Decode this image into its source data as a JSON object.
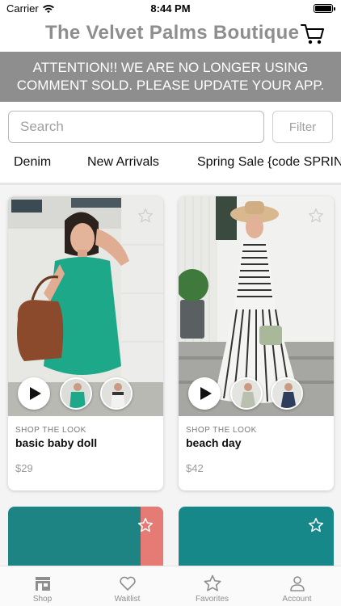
{
  "status_bar": {
    "carrier": "Carrier",
    "time": "8:44 PM"
  },
  "header": {
    "title": "The Velvet Palms Boutique"
  },
  "banner": {
    "line1": "ATTENTION!! WE ARE NO LONGER USING",
    "line2": "COMMENT SOLD. PLEASE UPDATE YOUR APP."
  },
  "search": {
    "placeholder": "Search",
    "value": ""
  },
  "filter": {
    "label": "Filter"
  },
  "categories": [
    "Denim",
    "New Arrivals",
    "Spring Sale {code SPRIN"
  ],
  "products": [
    {
      "tag": "SHOP THE LOOK",
      "name": "basic baby doll",
      "price": "$29"
    },
    {
      "tag": "SHOP THE LOOK",
      "name": "beach day",
      "price": "$42"
    }
  ],
  "tabs": [
    {
      "label": "Shop",
      "icon": "store-icon"
    },
    {
      "label": "Waitlist",
      "icon": "heart-icon"
    },
    {
      "label": "Favorites",
      "icon": "star-icon"
    },
    {
      "label": "Account",
      "icon": "person-icon"
    }
  ],
  "colors": {
    "brand_gray": "#8e8e8e",
    "banner_bg": "#8e8e8e",
    "teal": "#1b8a8a",
    "coral": "#e57b74"
  }
}
